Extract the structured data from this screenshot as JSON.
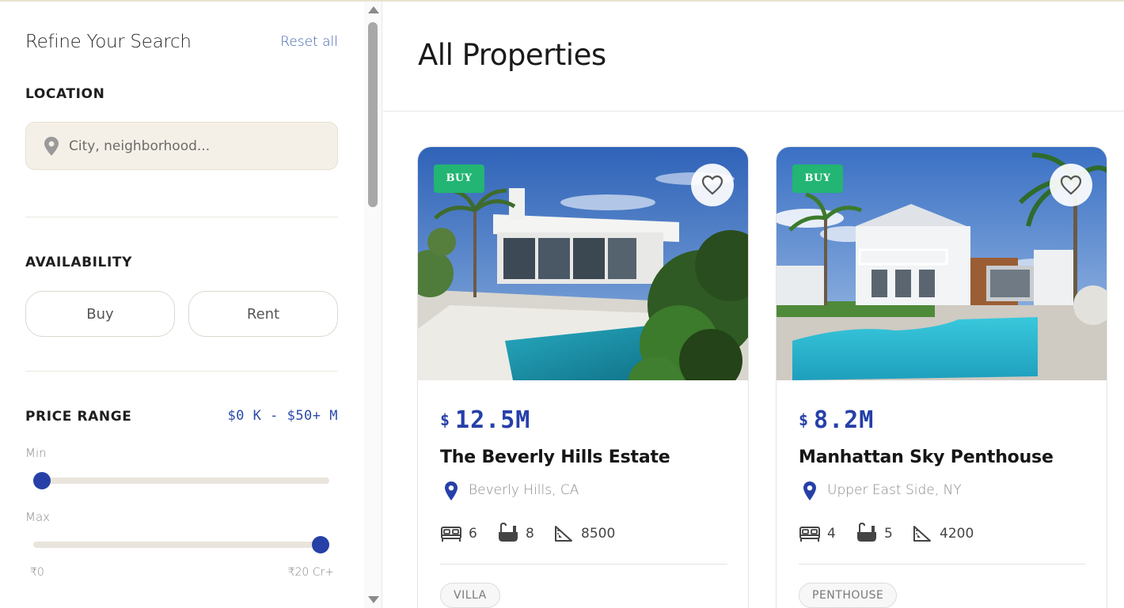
{
  "sidebar": {
    "title": "Refine Your Search",
    "reset_label": "Reset all",
    "location": {
      "label": "LOCATION",
      "placeholder": "City, neighborhood..."
    },
    "availability": {
      "label": "AVAILABILITY",
      "options": [
        "Buy",
        "Rent"
      ]
    },
    "price_range": {
      "label": "PRICE RANGE",
      "value_text": "$0 K - $50+ M",
      "min_label": "Min",
      "max_label": "Max",
      "min_fraction": 0.0,
      "max_fraction": 1.0,
      "range_start": "₹0",
      "range_end": "₹20 Cr+"
    }
  },
  "main": {
    "title": "All Properties",
    "cards": [
      {
        "badge": "BUY",
        "currency": "$",
        "price": "12.5M",
        "name": "The Beverly Hills Estate",
        "location": "Beverly Hills, CA",
        "beds": "6",
        "baths": "8",
        "area": "8500",
        "tag": "VILLA"
      },
      {
        "badge": "BUY",
        "currency": "$",
        "price": "8.2M",
        "name": "Manhattan Sky Penthouse",
        "location": "Upper East Side, NY",
        "beds": "4",
        "baths": "5",
        "area": "4200",
        "tag": "PENTHOUSE"
      }
    ]
  },
  "colors": {
    "accent_blue": "#2640a8",
    "badge_green": "#22b573",
    "input_bg": "#f5f0e7"
  },
  "icons": [
    "map-pin-icon",
    "heart-icon",
    "bed-icon",
    "bath-icon",
    "area-icon",
    "scroll-up-arrow-icon",
    "scroll-down-arrow-icon"
  ]
}
